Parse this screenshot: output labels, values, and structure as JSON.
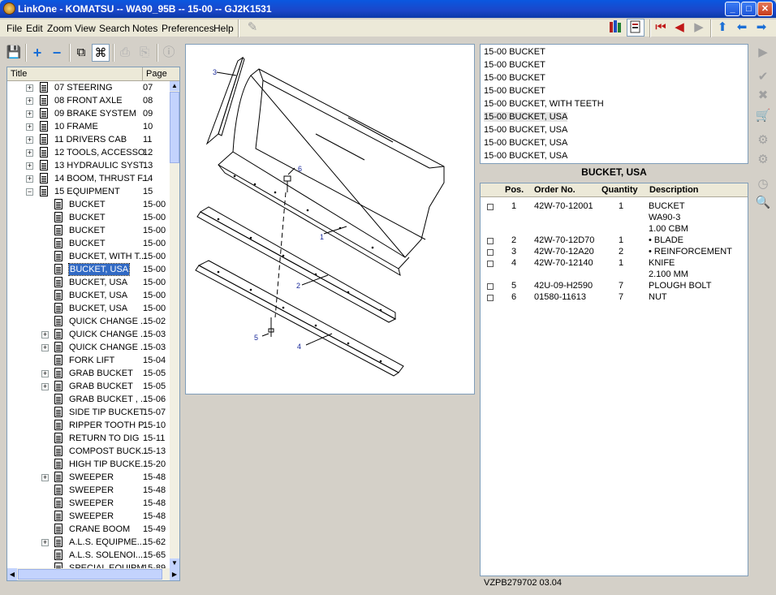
{
  "window": {
    "title": "LinkOne - KOMATSU -- WA90_95B -- 15-00 -- GJ2K1531"
  },
  "menu": [
    "File",
    "Edit",
    "Zoom",
    "View",
    "Search",
    "Notes",
    "Preferences",
    "Help"
  ],
  "tree": {
    "header_title": "Title",
    "header_page": "Page",
    "rows": [
      {
        "label": "07 STEERING",
        "page": "07"
      },
      {
        "label": "08 FRONT AXLE",
        "page": "08"
      },
      {
        "label": "09 BRAKE SYSTEM",
        "page": "09"
      },
      {
        "label": "10 FRAME",
        "page": "10"
      },
      {
        "label": "11 DRIVERS CAB",
        "page": "11"
      },
      {
        "label": "12 TOOLS, ACCESSO...",
        "page": "12"
      },
      {
        "label": "13 HYDRAULIC SYST...",
        "page": "13"
      },
      {
        "label": "14 BOOM, THRUST F...",
        "page": "14"
      },
      {
        "label": "15 EQUIPMENT",
        "page": "15"
      },
      {
        "label": "BUCKET",
        "page": "15-00"
      },
      {
        "label": "BUCKET",
        "page": "15-00"
      },
      {
        "label": "BUCKET",
        "page": "15-00"
      },
      {
        "label": "BUCKET",
        "page": "15-00"
      },
      {
        "label": "BUCKET, WITH T...",
        "page": "15-00"
      },
      {
        "label": "BUCKET, USA",
        "page": "15-00"
      },
      {
        "label": "BUCKET, USA",
        "page": "15-00"
      },
      {
        "label": "BUCKET, USA",
        "page": "15-00"
      },
      {
        "label": "BUCKET, USA",
        "page": "15-00"
      },
      {
        "label": "QUICK CHANGE ...",
        "page": "15-02"
      },
      {
        "label": "QUICK CHANGE ...",
        "page": "15-03"
      },
      {
        "label": "QUICK CHANGE ...",
        "page": "15-03"
      },
      {
        "label": "FORK LIFT",
        "page": "15-04"
      },
      {
        "label": "GRAB BUCKET",
        "page": "15-05"
      },
      {
        "label": "GRAB BUCKET",
        "page": "15-05"
      },
      {
        "label": "GRAB BUCKET , ...",
        "page": "15-06"
      },
      {
        "label": "SIDE TIP BUCKET",
        "page": "15-07"
      },
      {
        "label": "RIPPER TOOTH P...",
        "page": "15-10"
      },
      {
        "label": "RETURN TO DIG",
        "page": "15-11"
      },
      {
        "label": "COMPOST BUCK...",
        "page": "15-13"
      },
      {
        "label": "HIGH TIP BUCKE...",
        "page": "15-20"
      },
      {
        "label": "SWEEPER",
        "page": "15-48"
      },
      {
        "label": "SWEEPER",
        "page": "15-48"
      },
      {
        "label": "SWEEPER",
        "page": "15-48"
      },
      {
        "label": "SWEEPER",
        "page": "15-48"
      },
      {
        "label": "CRANE BOOM",
        "page": "15-49"
      },
      {
        "label": "A.L.S. EQUIPME...",
        "page": "15-62"
      },
      {
        "label": "A.L.S. SOLENOI...",
        "page": "15-65"
      },
      {
        "label": "SPECIAL EQUIPM...",
        "page": "15-89"
      }
    ]
  },
  "diagram": {
    "callouts": [
      "1",
      "2",
      "3",
      "4",
      "5",
      "6"
    ]
  },
  "pagelist": [
    "15-00 BUCKET",
    "15-00 BUCKET",
    "15-00 BUCKET",
    "15-00 BUCKET",
    "15-00 BUCKET, WITH TEETH",
    "15-00 BUCKET, USA",
    "15-00 BUCKET, USA",
    "15-00 BUCKET, USA",
    "15-00 BUCKET, USA"
  ],
  "parts": {
    "title": "BUCKET, USA",
    "headers": {
      "pos": "Pos.",
      "order": "Order No.",
      "qty": "Quantity",
      "desc": "Description"
    },
    "rows": [
      {
        "pos": "1",
        "order": "42W-70-12001",
        "qty": "1",
        "desc": [
          "BUCKET",
          "WA90-3",
          "1.00 CBM"
        ]
      },
      {
        "pos": "2",
        "order": "42W-70-12D70",
        "qty": "1",
        "desc": [
          "•  BLADE"
        ]
      },
      {
        "pos": "3",
        "order": "42W-70-12A20",
        "qty": "2",
        "desc": [
          "•  REINFORCEMENT"
        ]
      },
      {
        "pos": "4",
        "order": "42W-70-12140",
        "qty": "1",
        "desc": [
          "KNIFE",
          "2.100 MM"
        ]
      },
      {
        "pos": "5",
        "order": "42U-09-H2590",
        "qty": "7",
        "desc": [
          "PLOUGH BOLT"
        ]
      },
      {
        "pos": "6",
        "order": "01580-11613",
        "qty": "7",
        "desc": [
          "NUT"
        ]
      }
    ]
  },
  "status": {
    "text": "VZPB279702 03.04"
  }
}
